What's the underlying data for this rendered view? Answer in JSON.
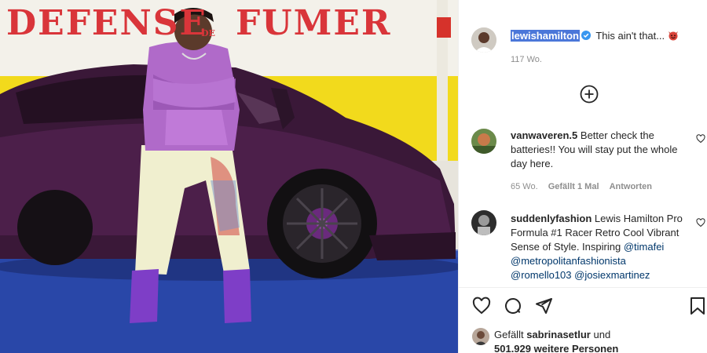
{
  "photo": {
    "wall_text_left": "DEFENSE",
    "wall_text_small": "DE",
    "wall_text_right": "FUMER"
  },
  "post": {
    "author": "lewishamilton",
    "caption": "This ain't that...",
    "caption_emoji": "devil-emoji",
    "age": "117 Wo."
  },
  "load_more_icon": "plus-circle-icon",
  "comments": [
    {
      "user": "vanwaveren.5",
      "text": "Better check the batteries!! You will stay put the whole day here.",
      "age": "65 Wo.",
      "likes": "Gefällt 1 Mal",
      "reply": "Antworten"
    },
    {
      "user": "suddenlyfashion",
      "text": "Lewis Hamilton Pro Formula #1 Racer Retro Cool Vibrant Sense of Style. Inspiring",
      "mentions": [
        "@timafei",
        "@metropolitanfashionista",
        "@romello103",
        "@josiexmartinez"
      ]
    }
  ],
  "likes": {
    "prefix": "Gefällt",
    "user": "sabrinasetlur",
    "conj": "und",
    "count": "501.929 weitere Personen"
  },
  "colors": {
    "selection": "#4b77d9",
    "verified": "#3897f0",
    "mention": "#00376b",
    "meta": "#8e8e8e"
  }
}
